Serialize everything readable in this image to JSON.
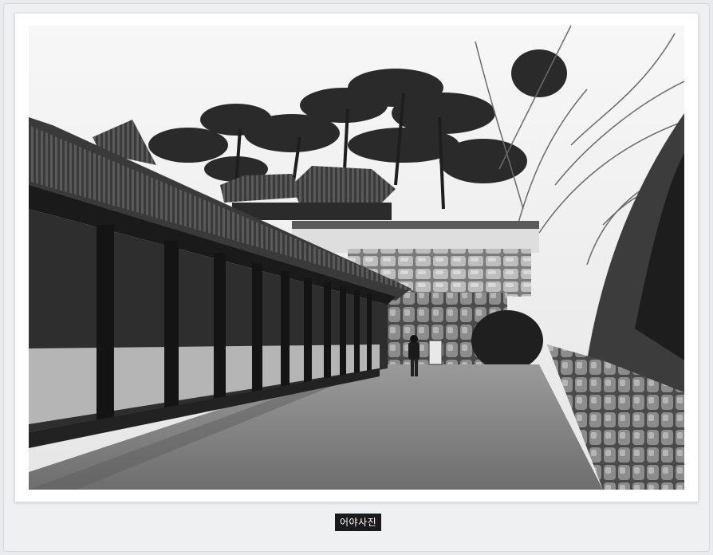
{
  "caption": {
    "text": "어야사진"
  },
  "photo": {
    "subject": "black-and-white-photograph"
  },
  "colors": {
    "frame_background": "#eef0f2",
    "mat": "#ffffff",
    "caption_background": "#1a1a1a",
    "caption_text": "#ffffff"
  }
}
